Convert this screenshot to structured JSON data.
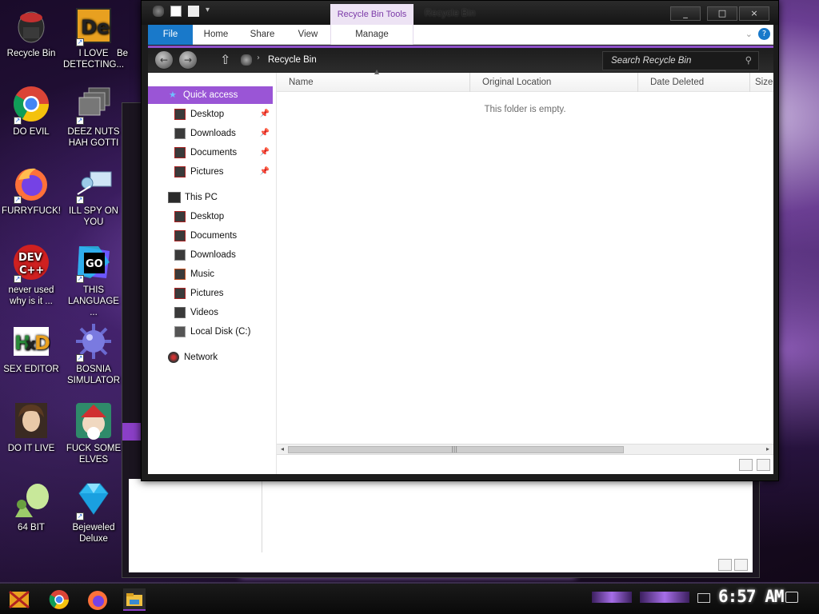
{
  "desktop": {
    "icons": [
      {
        "label": "Recycle Bin",
        "icon": "recycle-bin-icon"
      },
      {
        "label": "I LOVE DETECTING...",
        "icon": "detective-icon"
      },
      {
        "label": "Be",
        "icon": "partial-icon"
      },
      {
        "label": "DO EVIL",
        "icon": "chrome-icon"
      },
      {
        "label": "DEEZ NUTS HAH GOTTI",
        "icon": "windows-stack-icon"
      },
      {
        "label": "FURRYFUCK!",
        "icon": "firefox-icon"
      },
      {
        "label": "ILL SPY ON YOU",
        "icon": "network-spy-icon"
      },
      {
        "label": "never used why is it ...",
        "icon": "dev-cpp-icon"
      },
      {
        "label": "THIS LANGUAGE ...",
        "icon": "goland-icon"
      },
      {
        "label": "SEX EDITOR",
        "icon": "hxd-icon"
      },
      {
        "label": "BOSNIA SIMULATOR",
        "icon": "mine-icon"
      },
      {
        "label": "DO IT LIVE",
        "icon": "portrait-icon"
      },
      {
        "label": "FUCK SOME ELVES",
        "icon": "elf-icon"
      },
      {
        "label": "64 BIT",
        "icon": "gem-character-icon"
      },
      {
        "label": "Bejeweled Deluxe",
        "icon": "diamond-icon"
      }
    ]
  },
  "window": {
    "title": "Recycle Bin",
    "context_tab": "Recycle Bin Tools",
    "buttons": {
      "minimize": "_",
      "maximize": "□",
      "close": "×"
    },
    "ribbon": {
      "file": "File",
      "tabs": [
        "Home",
        "Share",
        "View"
      ],
      "manage": "Manage"
    },
    "address": {
      "path": "Recycle Bin",
      "search_placeholder": "Search Recycle Bin"
    },
    "nav": {
      "quick_access": "Quick access",
      "quick_items": [
        "Desktop",
        "Downloads",
        "Documents",
        "Pictures"
      ],
      "this_pc": "This PC",
      "pc_items": [
        "Desktop",
        "Documents",
        "Downloads",
        "Music",
        "Pictures",
        "Videos",
        "Local Disk (C:)"
      ],
      "network": "Network"
    },
    "columns": [
      "Name",
      "Original Location",
      "Date Deleted",
      "Size"
    ],
    "empty_message": "This folder is empty."
  },
  "taskbar": {
    "clock": "6:57 AM"
  },
  "colors": {
    "accent": "#9a55d6",
    "file_tab": "#1979ca",
    "context_tab_bg": "#ede3f4"
  }
}
